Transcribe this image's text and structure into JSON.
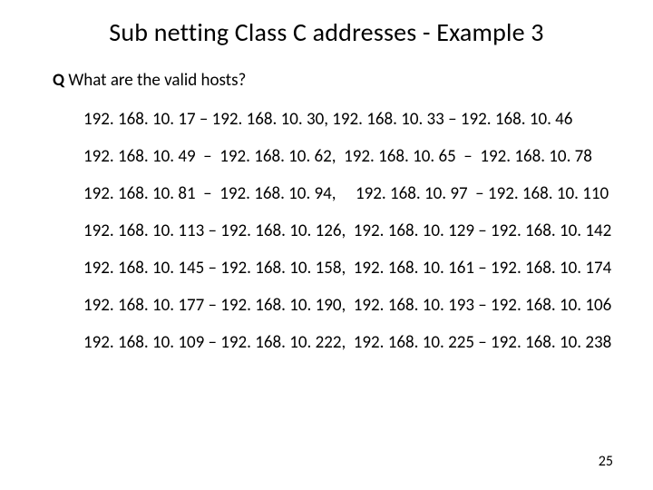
{
  "title": "Sub netting Class C addresses - Example 3",
  "question_label": "Q",
  "question_text": " What are the valid hosts?",
  "rows": [
    "192. 168. 10. 17 – 192. 168. 10. 30, 192. 168. 10. 33 – 192. 168. 10. 46",
    "192. 168. 10. 49  –  192. 168. 10. 62,  192. 168. 10. 65  –  192. 168. 10. 78",
    "192. 168. 10. 81  –  192. 168. 10. 94,     192. 168. 10. 97  – 192. 168. 10. 110",
    "192. 168. 10. 113 – 192. 168. 10. 126,  192. 168. 10. 129 – 192. 168. 10. 142",
    "192. 168. 10. 145 – 192. 168. 10. 158,  192. 168. 10. 161 – 192. 168. 10. 174",
    "192. 168. 10. 177 – 192. 168. 10. 190,  192. 168. 10. 193 – 192. 168. 10. 106",
    "192. 168. 10. 109 – 192. 168. 10. 222,  192. 168. 10. 225 – 192. 168. 10. 238"
  ],
  "page_number": "25"
}
